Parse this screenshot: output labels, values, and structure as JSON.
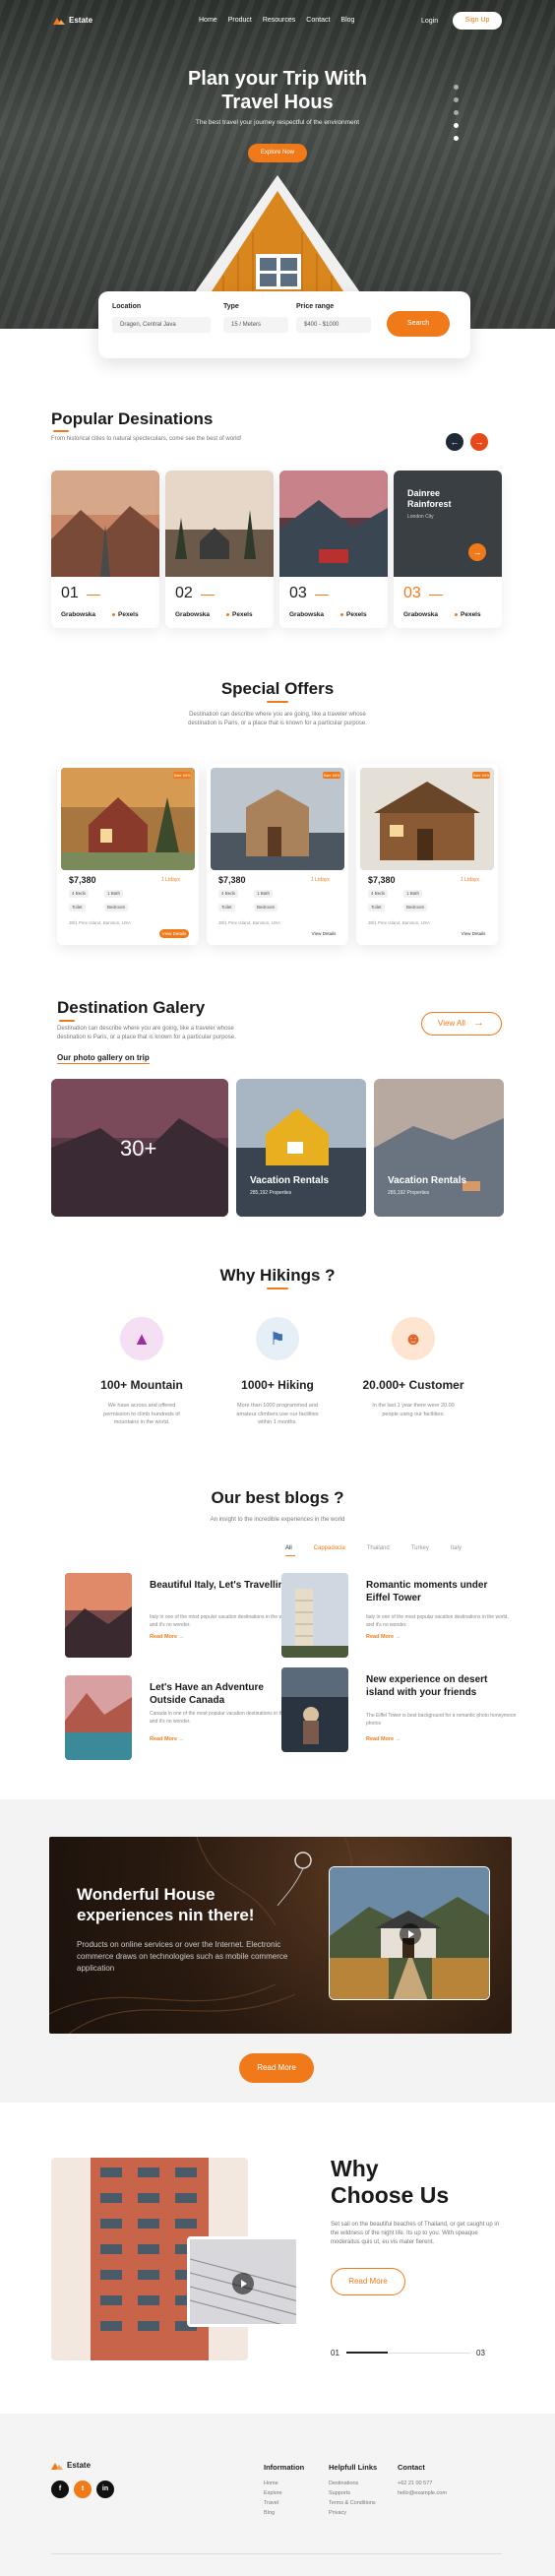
{
  "nav": {
    "brand": "Estate",
    "links": [
      "Home",
      "Product",
      "Resources",
      "Contact",
      "Blog"
    ],
    "login": "Login",
    "signup": "Sign Up"
  },
  "hero": {
    "title_line1": "Plan your Trip With",
    "title_line2": "Travel Hous",
    "subtitle": "The best travel your journey respectful of the environment",
    "cta": "Explore Now"
  },
  "search": {
    "location_label": "Location",
    "location_value": "Dragen, Central Java",
    "type_label": "Type",
    "type_value": "15 / Meters",
    "price_label": "Price range",
    "price_value": "$400 - $1000",
    "button": "Search"
  },
  "popular": {
    "title": "Popular Desinations",
    "subtitle": "From historical cities to natural specteculars, come see the best of world!",
    "cards": [
      {
        "num": "01",
        "city": "Grabowska",
        "source": "Pexels"
      },
      {
        "num": "02",
        "city": "Grabowska",
        "source": "Pexels"
      },
      {
        "num": "03",
        "city": "Grabowska",
        "source": "Pexels"
      },
      {
        "num": "03",
        "city": "Grabowska",
        "source": "Pexels",
        "overlay_title": "Dainree Rainforest",
        "overlay_sub": "London City"
      }
    ]
  },
  "offers": {
    "title": "Special Offers",
    "subtitle_1": "Destination can describe where you are going, like a traveler whose",
    "subtitle_2": "destination is Paris, or a place that is known for a particular purpose.",
    "cards": [
      {
        "price": "$7,380",
        "tag": "Sale 40%",
        "label": "1 Ltdays",
        "beds": "4 Beds",
        "baths": "1 Bath",
        "other1": "Toilet",
        "other2": "Bedroom",
        "location": "39/1 Pine Island, Banston, USA",
        "details": "View Details"
      },
      {
        "price": "$7,380",
        "tag": "Sale 40%",
        "label": "1 Ltdays",
        "beds": "4 Beds",
        "baths": "1 Bath",
        "other1": "Toilet",
        "other2": "Bedroom",
        "location": "39/1 Pine Island, Banston, USA",
        "details": "View Details"
      },
      {
        "price": "$7,380",
        "tag": "Sale 40%",
        "label": "1 Ltdays",
        "beds": "4 Beds",
        "baths": "1 Bath",
        "other1": "Toilet",
        "other2": "Bedroom",
        "location": "39/1 Pine Island, Banston, USA",
        "details": "View Details"
      }
    ]
  },
  "gallery": {
    "title": "Destination Galery",
    "subtitle_1": "Destination can describe where you are going, like a traveler whose",
    "subtitle_2": "destination is Paris, or a place that is known for a particular purpose.",
    "link": "Our photo gallery on trip",
    "view_all": "View All",
    "count": "30+",
    "items": [
      {
        "title": "Vacation Rentals",
        "sub": "285,192 Properties"
      },
      {
        "title": "Vacation Rentals",
        "sub": "285,192 Properties"
      }
    ]
  },
  "hikings": {
    "title": "Why Hikings ?",
    "items": [
      {
        "title": "100+ Mountain",
        "desc": "We have across and offered permission to climb hundreds of mountains in the world."
      },
      {
        "title": "1000+ Hiking",
        "desc": "More than 1000 programmed and amateur climbers use our facilities within 1 months."
      },
      {
        "title": "20.000+ Customer",
        "desc": "In the last 1 year there were 20.00 people using our facilities."
      }
    ]
  },
  "blogs": {
    "title": "Our best blogs ?",
    "subtitle": "An insight to the incredible experiences in the world",
    "tabs": [
      "All",
      "Cappadocia",
      "Thailand",
      "Turkey",
      "Italy"
    ],
    "items": [
      {
        "title": "Beautiful Italy, Let's Travelling!",
        "desc": "Italy in one of the most popular vacation destinations in the world, and it's no wonder.",
        "read": "Read More"
      },
      {
        "title": "Romantic moments under Eiffel Tower",
        "desc": "Italy in one of the most popular vacation destinations in the world, and it's no wonder.",
        "read": "Read More"
      },
      {
        "title": "Let's Have an Adventure Outside Canada",
        "desc": "Canada in one of the most popular vacation destinations in the world, and it's no wonder.",
        "read": "Read More"
      },
      {
        "title": "New experience on desert island with your friends",
        "desc": "The Eiffel Tower is best background for a romantic photo honeymoon photos",
        "read": "Read More"
      }
    ]
  },
  "promo": {
    "title_1": "Wonderful House",
    "title_2": "experiences nin there!",
    "desc": "Products on online services or over the Internet. Electronic commerce draws on technologies such as mobile commerce application",
    "button": "Read More"
  },
  "why": {
    "title_1": "Why",
    "title_2": "Choose Us",
    "desc": "Set sail on the beautiful beaches of Thailand, or get caught up in the wildness of the night life. Its up to you. With speaque moderaitus quis ut, eu vis mater fierent.",
    "button": "Read More",
    "page_from": "01",
    "page_to": "03"
  },
  "footer": {
    "brand": "Estate",
    "col1_title": "Information",
    "col1": [
      "Home",
      "Explore",
      "Travel",
      "Blog"
    ],
    "col2_title": "Helpfull Links",
    "col2": [
      "Destinations",
      "Supports",
      "Terms & Conditions",
      "Privacy"
    ],
    "col3_title": "Contact",
    "col3": [
      "+62 21 00 577",
      "hello@example.com"
    ],
    "social": [
      "f",
      "t",
      "in"
    ]
  },
  "colors": {
    "accent": "#f07a1a",
    "dark": "#1a1a1a"
  }
}
